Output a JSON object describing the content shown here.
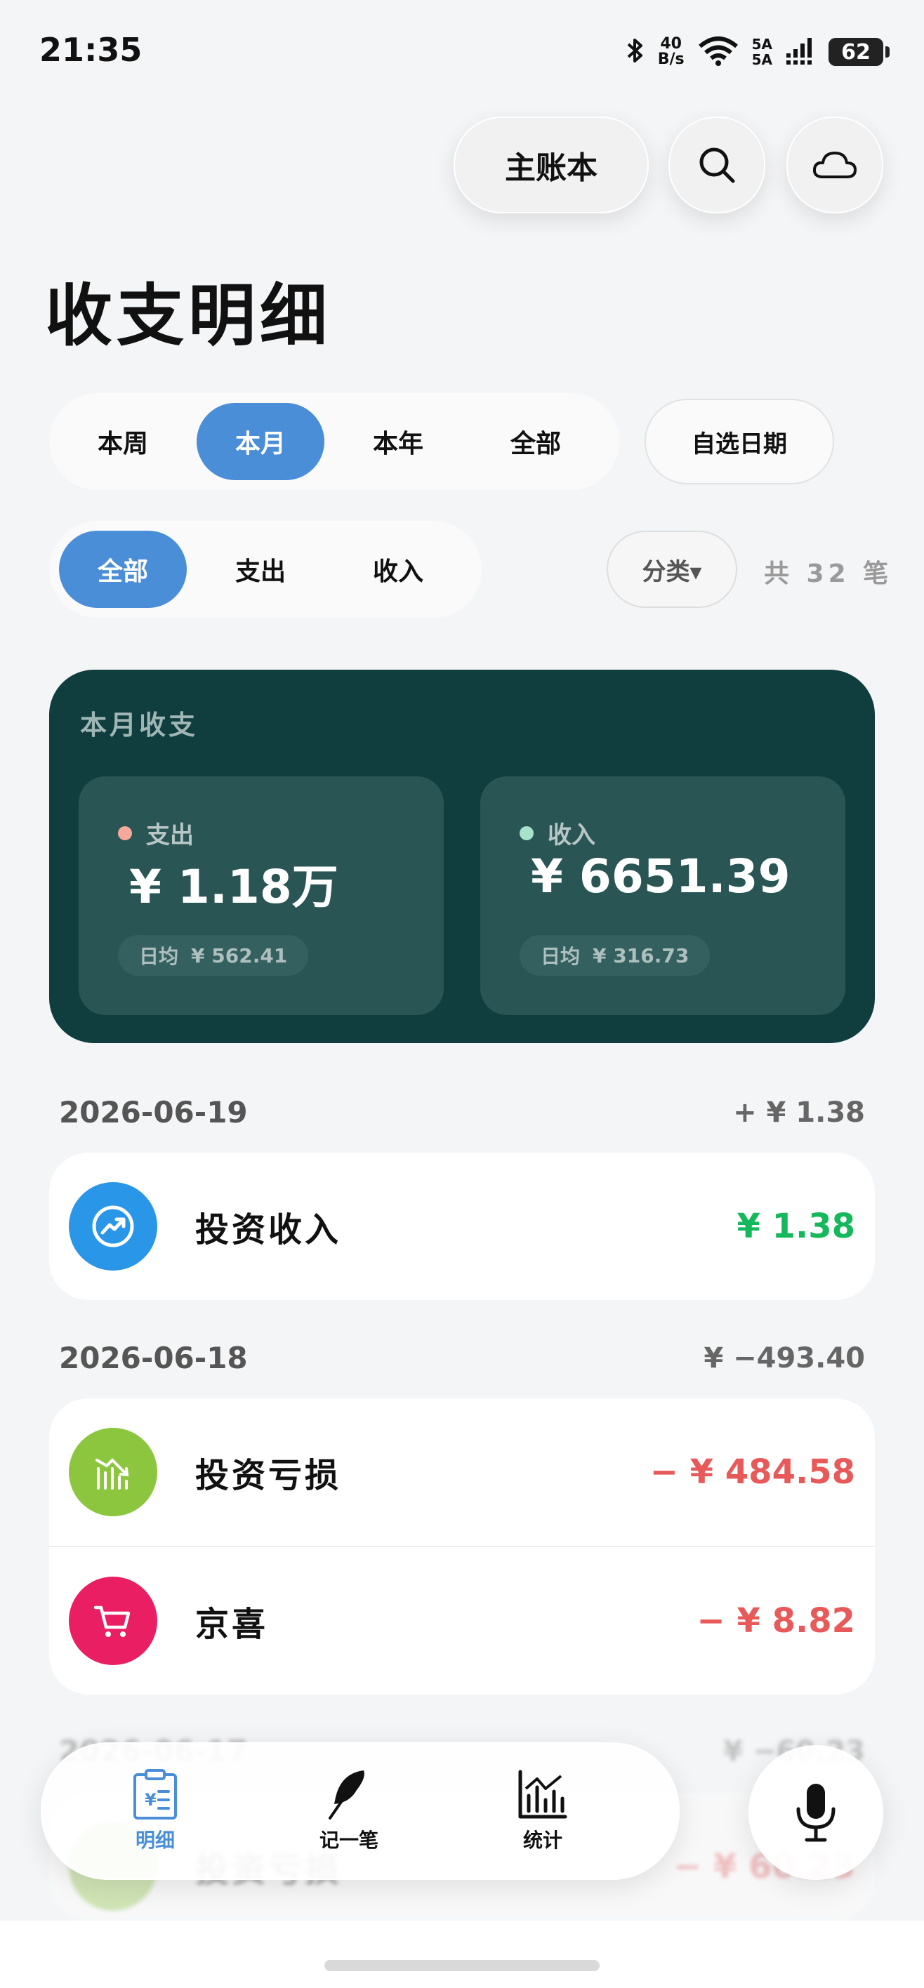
{
  "status": {
    "time": "21:35",
    "net_speed_value": "40",
    "net_speed_unit": "B/s",
    "signal_1": "5A",
    "signal_2": "5A",
    "battery": "62"
  },
  "header": {
    "book_label": "主账本",
    "title": "收支明细"
  },
  "range_tabs": {
    "items": [
      {
        "label": "本周"
      },
      {
        "label": "本月"
      },
      {
        "label": "本年"
      },
      {
        "label": "全部"
      }
    ],
    "active": "本月",
    "custom_label": "自选日期"
  },
  "type_tabs": {
    "items": [
      {
        "label": "全部"
      },
      {
        "label": "支出"
      },
      {
        "label": "收入"
      }
    ],
    "active": "全部",
    "category_label": "分类▾",
    "count_label": "共 32 笔"
  },
  "summary": {
    "title": "本月收支",
    "expense": {
      "label": "支出",
      "amount": "¥ 1.18万",
      "avg_label": "日均",
      "avg_value": "¥ 562.41"
    },
    "income": {
      "label": "收入",
      "amount": "¥ 6651.39",
      "avg_label": "日均",
      "avg_value": "¥ 316.73"
    }
  },
  "days": [
    {
      "date": "2026-06-19",
      "total": "+ ¥ 1.38",
      "entries": [
        {
          "name": "投资收入",
          "amount": "¥ 1.38",
          "icon": "investment-income-icon"
        }
      ]
    },
    {
      "date": "2026-06-18",
      "total": "¥ −493.40",
      "entries": [
        {
          "name": "投资亏损",
          "amount": "− ¥ 484.58",
          "icon": "investment-loss-icon"
        },
        {
          "name": "京喜",
          "amount": "− ¥ 8.82",
          "icon": "cart-icon"
        }
      ]
    },
    {
      "date": "2026-06-17",
      "total": "¥ −60.23",
      "entries": [
        {
          "name": "投资亏损",
          "amount": "− ¥ 60.23",
          "icon": "investment-loss-icon"
        }
      ]
    }
  ],
  "nav": {
    "items": [
      {
        "label": "明细"
      },
      {
        "label": "记一笔"
      },
      {
        "label": "统计"
      }
    ],
    "active": "明细"
  },
  "colors": {
    "accent": "#4a8ed8",
    "card_bg": "#103d3e",
    "income": "#16b85c",
    "expense": "#e85a5a",
    "income_icon": "#2a96e8",
    "loss_icon": "#8cc63f",
    "cart_icon": "#e91e63",
    "expense_dot": "#f5a99a",
    "income_dot": "#a6e3c9"
  }
}
